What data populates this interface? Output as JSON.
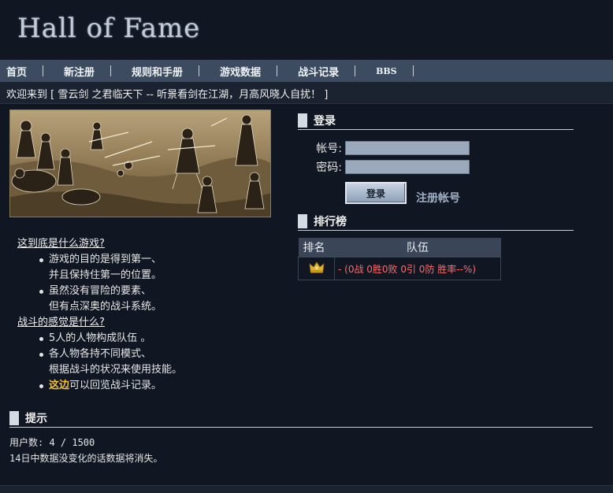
{
  "header": {
    "logo_text": "Hall of Fame"
  },
  "nav": {
    "items": [
      {
        "label": "首页"
      },
      {
        "label": "新注册"
      },
      {
        "label": "规则和手册"
      },
      {
        "label": "游戏数据"
      },
      {
        "label": "战斗记录"
      },
      {
        "label": "BBS"
      }
    ]
  },
  "welcome": {
    "text": "欢迎来到 [ 雪云剑 之君临天下 -- 听景看剑在江湖，月高风晓人自扰！ ]"
  },
  "info": {
    "q1": "这到底是什么游戏?",
    "q1_items": [
      {
        "line1": "游戏的目的是得到第一、",
        "line2": "并且保持住第一的位置。"
      },
      {
        "line1": "虽然没有冒险的要素、",
        "line2": "但有点深奥的战斗系统。"
      }
    ],
    "q2": "战斗的感觉是什么?",
    "q2_items": [
      {
        "line1": "5人的人物构成队伍 。",
        "line2": ""
      },
      {
        "line1": "各人物各持不同模式、",
        "line2": "根据战斗的状况来使用技能。"
      }
    ],
    "q2_last_highlight": "这边",
    "q2_last_rest": "可以回览战斗记录。"
  },
  "login": {
    "title": "登录",
    "account_label": "帐号:",
    "account_value": "",
    "password_label": "密码:",
    "password_value": "",
    "button_label": "登录",
    "register_label": "注册帐号"
  },
  "ranking": {
    "title": "排行榜",
    "headers": [
      "排名",
      "队伍"
    ],
    "rows": [
      {
        "rank_icon": "crown-icon",
        "team": "- (0战 0胜0败 0引 0防 胜率--%)"
      }
    ]
  },
  "tips": {
    "title": "提示",
    "users": "用户数: 4 / 1500",
    "note": "14日中数据没变化的话数据将消失。"
  },
  "colors": {
    "highlight": "#f2c23a",
    "team_red": "#ff6a6a",
    "nav_bg": "#3c4b5f"
  }
}
